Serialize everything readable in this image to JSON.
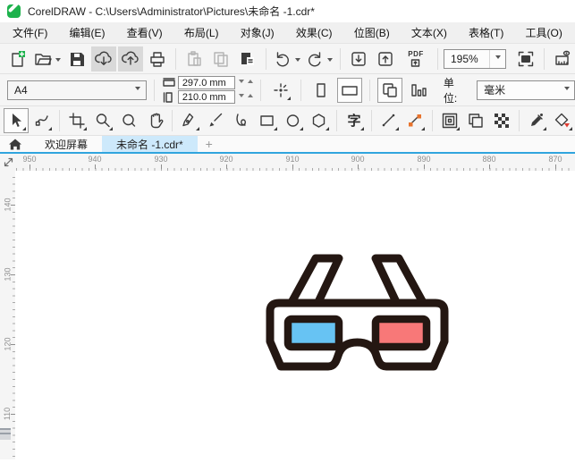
{
  "window": {
    "title": "CorelDRAW - C:\\Users\\Administrator\\Pictures\\未命名 -1.cdr*"
  },
  "menus": [
    "文件(F)",
    "编辑(E)",
    "查看(V)",
    "布局(L)",
    "对象(J)",
    "效果(C)",
    "位图(B)",
    "文本(X)",
    "表格(T)",
    "工具(O)"
  ],
  "toolbar": {
    "zoom_level": "195%",
    "pdf_label": "PDF"
  },
  "property_bar": {
    "page_size_preset": "A4",
    "page_width": "297.0 mm",
    "page_height": "210.0 mm",
    "units_label": "单位:",
    "units_value": "毫米"
  },
  "toolbox": {
    "text_tool_glyph": "字"
  },
  "tabs": {
    "welcome": "欢迎屏幕",
    "document": "未命名 -1.cdr*",
    "new_tab": "+"
  },
  "rulers": {
    "horizontal": {
      "labels": [
        950,
        940,
        930,
        920,
        910,
        900,
        890,
        880,
        870
      ]
    },
    "vertical": {
      "labels": [
        140,
        130,
        120,
        110
      ]
    }
  },
  "canvas": {
    "artwork": "3d-anaglyph-glasses",
    "colors": {
      "outline": "#241712",
      "frame_fill": "#ffffff",
      "left_lens": "#67c3f3",
      "right_lens": "#f87878"
    }
  },
  "colors": {
    "accent_blue": "#31a5de",
    "active_tab_bg": "#cde9fb",
    "logo_green": "#1db24c",
    "connector_node_orange": "#e8732c",
    "fill_tool_red": "#e03c31"
  }
}
